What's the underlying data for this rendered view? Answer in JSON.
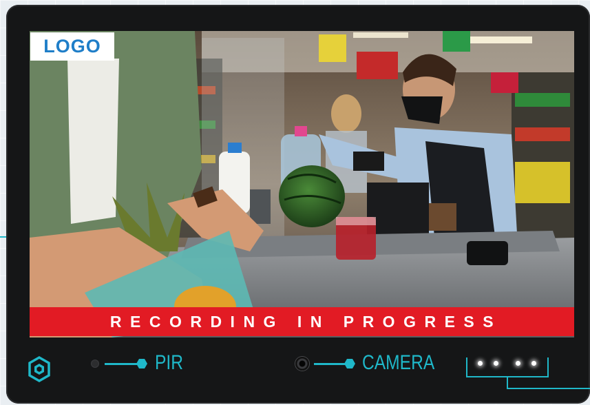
{
  "logo": {
    "text": "LOGO"
  },
  "banner": {
    "text": "RECORDING IN PROGRESS"
  },
  "sensors": {
    "pir_label": "PIR",
    "camera_label": "CAMERA"
  },
  "leds": {
    "count": 4
  },
  "colors": {
    "accent": "#1fb8c9",
    "banner": "#e21b24",
    "logo_text": "#1f7ec8",
    "device": "#151617"
  },
  "icons": [
    "brand-hexagon-icon",
    "pir-sensor-icon",
    "camera-lens-icon",
    "led-indicator-icon"
  ]
}
